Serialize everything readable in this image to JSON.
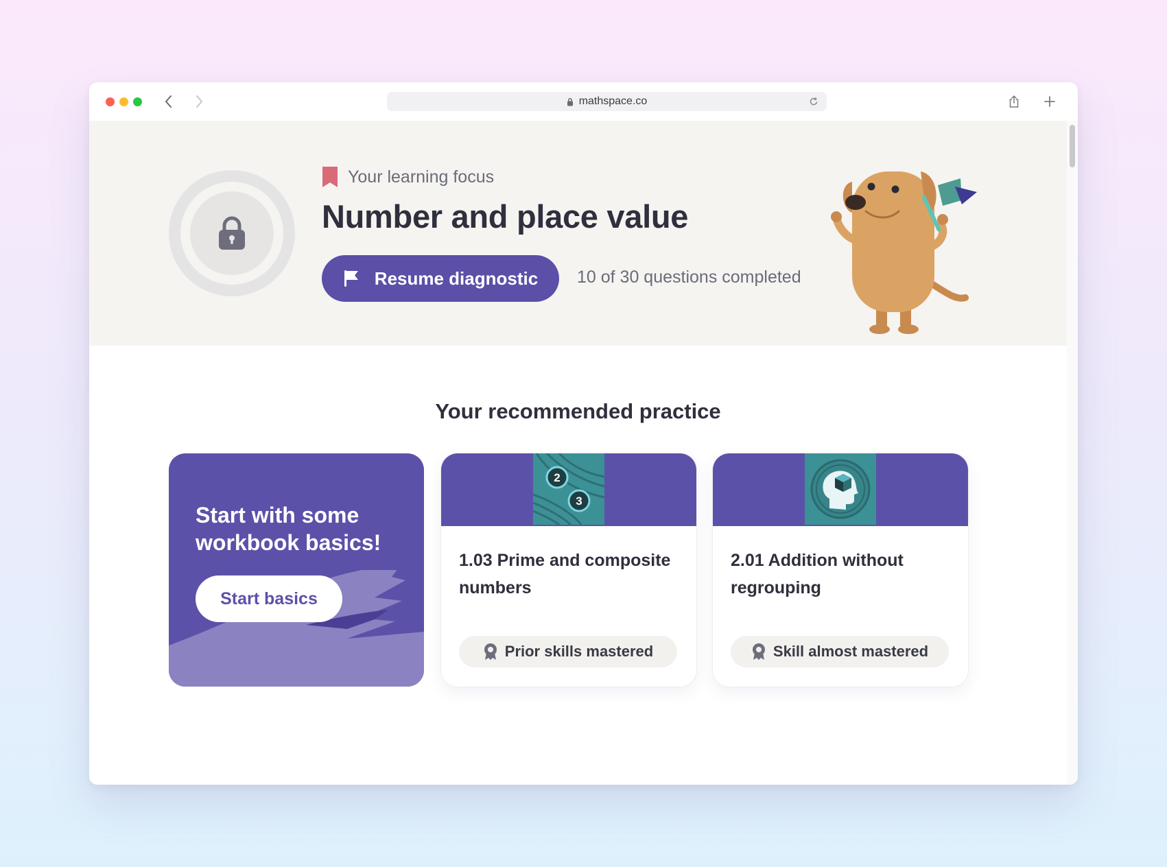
{
  "browser": {
    "url": "mathspace.co"
  },
  "hero": {
    "focus_label": "Your learning focus",
    "title": "Number and place value",
    "resume_label": "Resume diagnostic",
    "progress_text": "10 of 30 questions completed"
  },
  "practice": {
    "heading": "Your recommended practice",
    "start_card": {
      "title": "Start with some workbook basics!",
      "button_label": "Start basics"
    },
    "cards": [
      {
        "title": "1.03 Prime and composite numbers",
        "icon": "prime-numbers-icon",
        "numbers": [
          "2",
          "3"
        ],
        "status": "Prior skills mastered"
      },
      {
        "title": "2.01 Addition without regrouping",
        "icon": "head-cube-icon",
        "status": "Skill almost mastered"
      }
    ]
  },
  "colors": {
    "primary": "#5b4fa8",
    "teal_tile": "#3c9196",
    "hero_bg": "#f5f4f1"
  }
}
